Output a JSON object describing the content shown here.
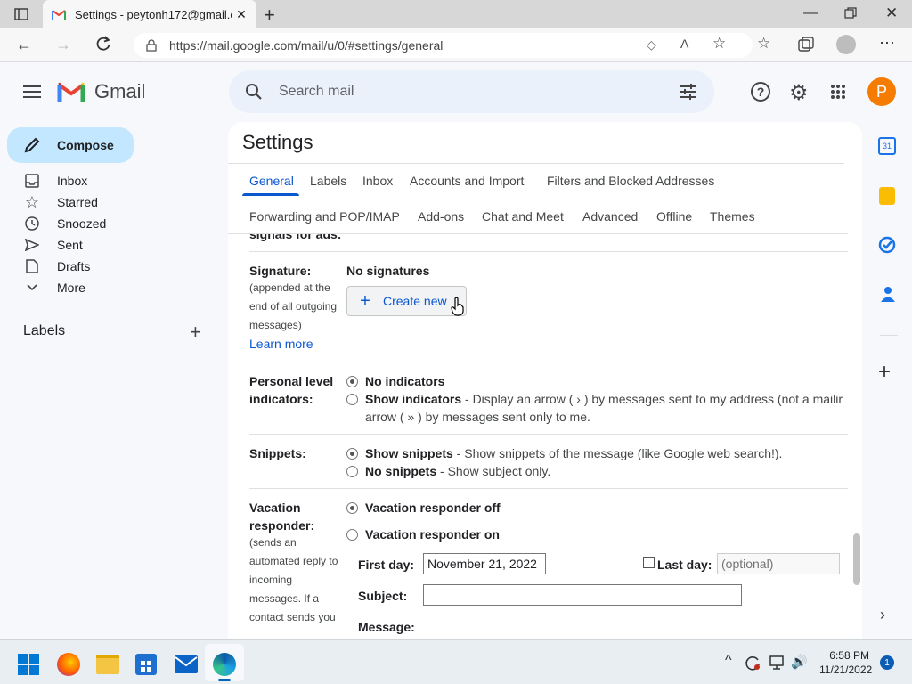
{
  "browser": {
    "tab_title": "Settings - peytonh172@gmail.cc",
    "url": "https://mail.google.com/mail/u/0/#settings/general",
    "new_tab": "+"
  },
  "gmail": {
    "logo_text": "Gmail",
    "search_placeholder": "Search mail",
    "avatar_letter": "P",
    "compose": "Compose",
    "nav": [
      "Inbox",
      "Starred",
      "Snoozed",
      "Sent",
      "Drafts",
      "More"
    ],
    "labels_heading": "Labels",
    "settings_title": "Settings",
    "tabs_row1": [
      "General",
      "Labels",
      "Inbox",
      "Accounts and Import",
      "Filters and Blocked Addresses"
    ],
    "tabs_row2": [
      "Forwarding and POP/IMAP",
      "Add-ons",
      "Chat and Meet",
      "Advanced",
      "Offline",
      "Themes"
    ],
    "clipped_text": "signals for ads:",
    "signature": {
      "label": "Signature:",
      "desc": [
        "(appended at the",
        "end of all outgoing",
        "messages)"
      ],
      "learn_more": "Learn more",
      "value": "No signatures",
      "create_new": "Create new"
    },
    "personal": {
      "label": [
        "Personal level",
        "indicators:"
      ],
      "opt1": "No indicators",
      "opt2_bold": "Show indicators",
      "opt2_rest": " - Display an arrow ( › ) by messages sent to my address (not a mailir",
      "opt2_line2": "arrow ( » ) by messages sent only to me."
    },
    "snippets": {
      "label": "Snippets:",
      "opt1_bold": "Show snippets",
      "opt1_rest": " - Show snippets of the message (like Google web search!).",
      "opt2_bold": "No snippets",
      "opt2_rest": " - Show subject only."
    },
    "vacation": {
      "label": [
        "Vacation",
        "responder:"
      ],
      "desc": [
        "(sends an",
        "automated reply to",
        "incoming",
        "messages. If a",
        "contact sends you"
      ],
      "off": "Vacation responder off",
      "on": "Vacation responder on",
      "first_day_label": "First day:",
      "first_day_value": "November 21, 2022",
      "last_day_label": "Last day:",
      "last_day_placeholder": "(optional)",
      "subject_label": "Subject:",
      "message_label": "Message:"
    }
  },
  "taskbar": {
    "time": "6:58 PM",
    "date": "11/21/2022",
    "notification_count": "1"
  },
  "colors": {
    "accent": "#0b57d0",
    "compose_bg": "#c2e7ff",
    "avatar": "#f57c00"
  }
}
